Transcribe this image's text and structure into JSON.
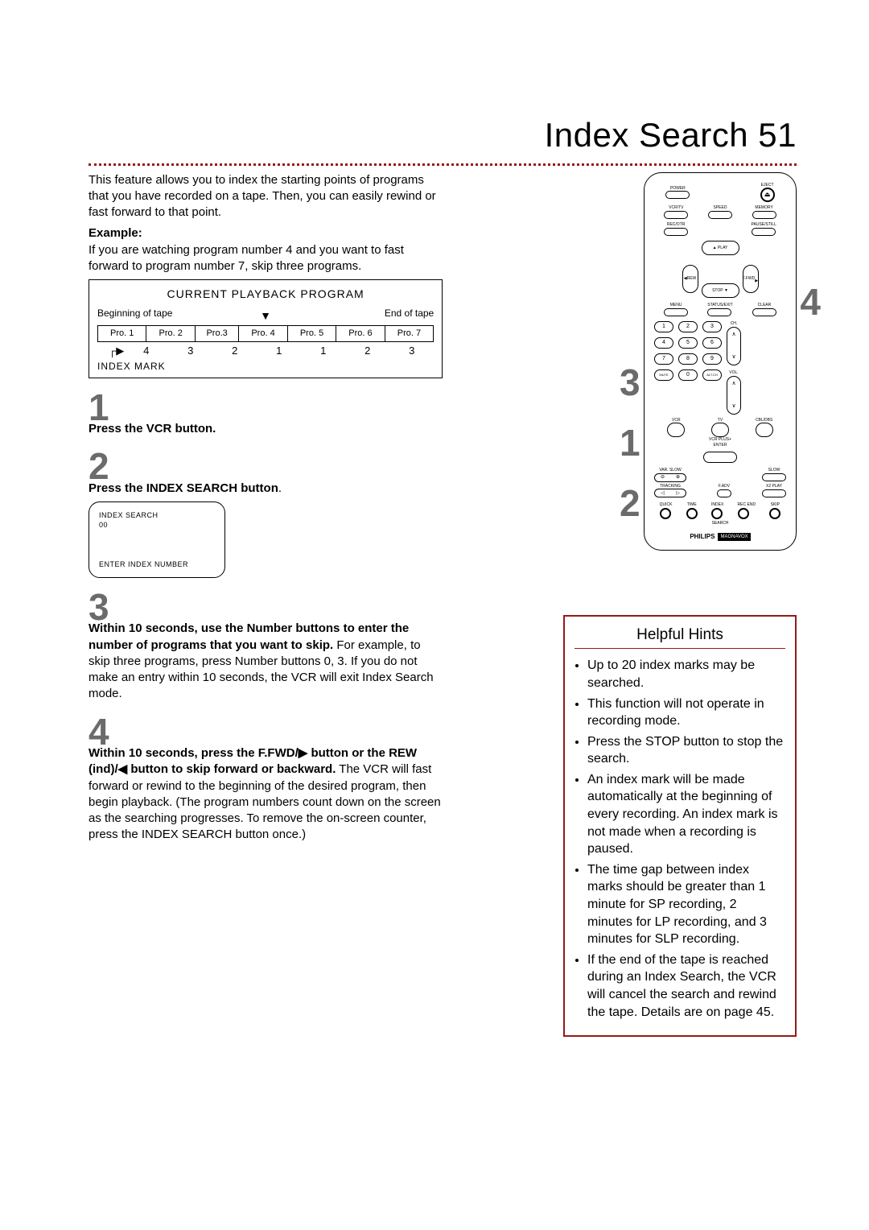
{
  "page": {
    "title": "Index Search",
    "number": "51"
  },
  "intro": "This feature allows you to index the starting points of programs that you have recorded on a tape. Then, you can easily rewind or fast forward to that point.",
  "example_label": "Example:",
  "example_text": "If you are watching program number 4 and you want to fast forward to program number 7, skip three programs.",
  "playback": {
    "title": "CURRENT PLAYBACK PROGRAM",
    "begin": "Beginning of tape",
    "end": "End of tape",
    "programs": [
      "Pro. 1",
      "Pro. 2",
      "Pro.3",
      "Pro. 4",
      "Pro. 5",
      "Pro. 6",
      "Pro. 7"
    ],
    "marks": [
      "4",
      "3",
      "2",
      "1",
      "1",
      "2",
      "3"
    ],
    "index_label": "INDEX MARK"
  },
  "steps": {
    "1": {
      "num": "1",
      "text_bold": "Press the VCR button."
    },
    "2": {
      "num": "2",
      "text_bold": "Press the INDEX SEARCH button",
      "text_rest": "."
    },
    "3": {
      "num": "3",
      "text_bold": "Within 10 seconds, use the Number buttons to enter the number of programs that you want to skip.",
      "text_rest": "  For example, to skip three programs, press Number buttons 0, 3.  If you do not make an entry within 10 seconds, the VCR will exit Index Search mode."
    },
    "4": {
      "num": "4",
      "text_bold": "Within 10 seconds, press the F.FWD/▶ button or the REW (ind)/◀  button to skip forward or backward.",
      "text_rest": " The VCR will fast forward or rewind to the beginning of the desired program, then begin playback. (The program numbers count down on the screen as the searching progresses. To remove the on-screen counter, press the INDEX SEARCH button once.)"
    }
  },
  "tvscreen": {
    "line1": "INDEX SEARCH",
    "line2": "00",
    "line3": "ENTER INDEX NUMBER"
  },
  "remote": {
    "power": "POWER",
    "eject": "EJECT",
    "vcrtv": "VCR/TV",
    "speed": "SPEED",
    "memory": "MEMORY",
    "recotr": "REC/OTR",
    "pausestill": "PAUSE/STILL",
    "play": "PLAY",
    "rew": "REW",
    "ffwd": "F.FWD",
    "stop": "STOP",
    "menu": "MENU",
    "statusexit": "STATUS/EXIT",
    "clear": "CLEAR",
    "nums": [
      "1",
      "2",
      "3",
      "4",
      "5",
      "6",
      "7",
      "8",
      "9",
      "MUTE",
      "0",
      "ALT.CH"
    ],
    "ch": "CH.",
    "vol": "VOL.",
    "vcr": "VCR",
    "tv": "TV",
    "cbldbs": "CBL/DBS",
    "vcrplus": "VCR PLUS+\nENTER",
    "varslow": "VAR. SLOW",
    "slow": "SLOW",
    "tracking": "TRACKING",
    "fadv": "F.ADV",
    "x2play": "X2 PLAY",
    "quick": "QUICK",
    "time": "TIME",
    "index": "INDEX",
    "recend": "REC END",
    "skip": "SKIP",
    "search": "SEARCH",
    "brand1": "PHILIPS",
    "brand2": "MAGNAVOX"
  },
  "callouts": {
    "c1": "1",
    "c2": "2",
    "c3": "3",
    "c4": "4"
  },
  "hints": {
    "title": "Helpful Hints",
    "items": [
      "Up to 20 index marks may be searched.",
      "This function will not operate in recording mode.",
      "Press the STOP button to stop the search.",
      "An index mark will be made automatically at the beginning of every recording. An index mark is not made when a recording is paused.",
      "The time gap between index marks should be greater than 1 minute for SP recording, 2 minutes for LP recording, and 3 minutes for SLP recording.",
      "If the end of the tape is reached during an Index Search, the VCR will cancel the search and rewind the tape. Details are on page 45."
    ]
  }
}
